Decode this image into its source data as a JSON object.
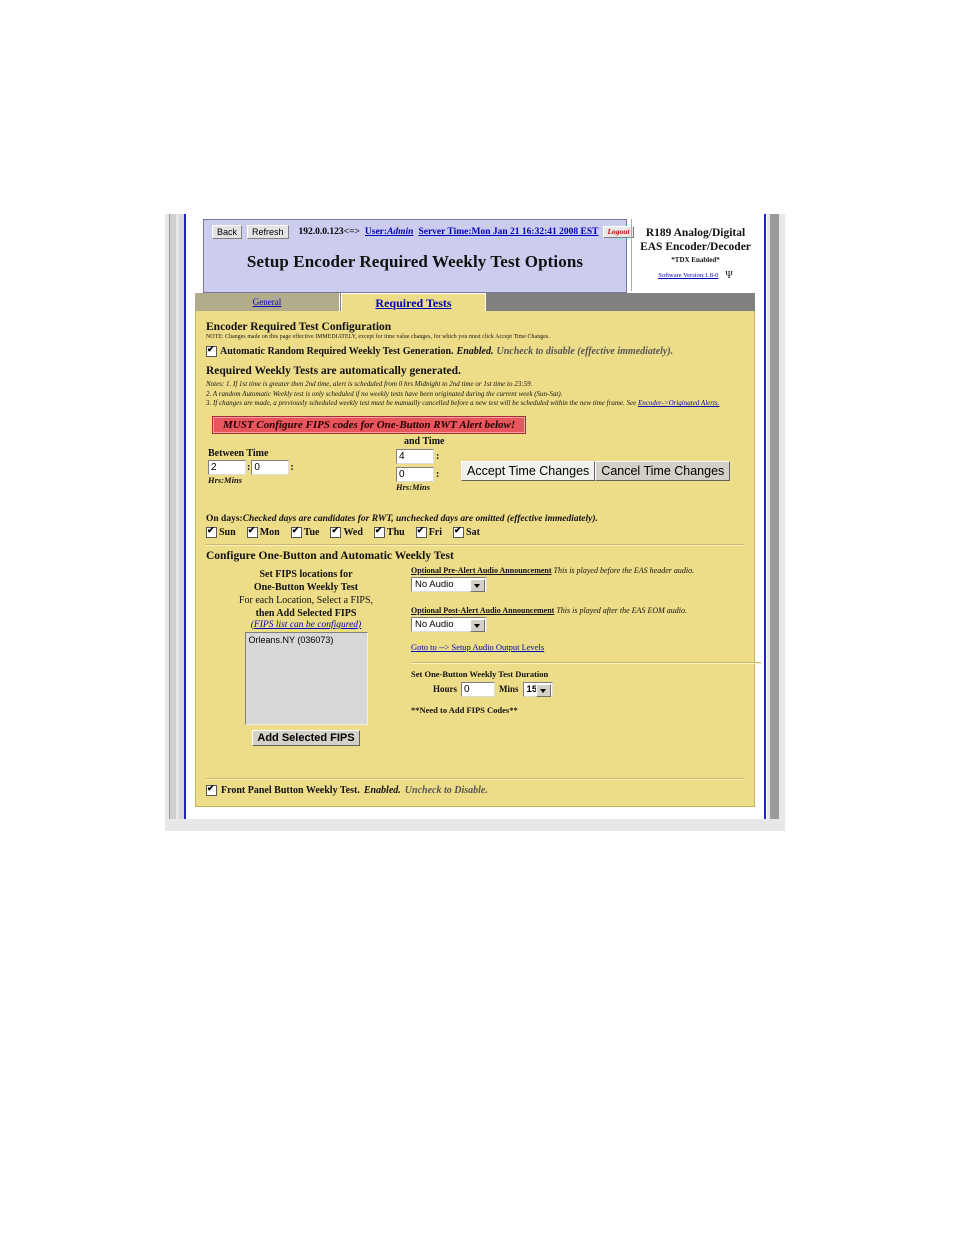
{
  "toolbar": {
    "back_label": "Back",
    "refresh_label": "Refresh",
    "ip": "192.0.0.123<=>",
    "user_label": "User:",
    "user_value": "Admin",
    "server_time": "Server Time:Mon Jan 21 16:32:41 2008 EST",
    "logout_label": "Logout"
  },
  "header": {
    "page_title": "Setup Encoder Required Weekly Test Options"
  },
  "product": {
    "line1": "R189 Analog/Digital",
    "line2": "EAS Encoder/Decoder",
    "subtitle": "*TDX Enabled*",
    "version_link": "Software Version:1.8-0",
    "logo_glyph": "Ψ"
  },
  "tabs": [
    {
      "label": "General",
      "active": false
    },
    {
      "label": "Required Tests",
      "active": true
    }
  ],
  "config": {
    "section_title": "Encoder Required Test Configuration",
    "note": "NOTE: Changes made on this page effective IMMEDIATELY, except for time value changes, for which you must click Accept Time Changes.",
    "auto_rwt_label": "Automatic Random Required Weekly Test Generation.",
    "auto_rwt_state": "Enabled.",
    "auto_rwt_hint": "Uncheck to disable (effective immediately).",
    "auto_rwt_checked": true,
    "generated_heading": "Required Weekly Tests are automatically generated.",
    "notes": [
      "Notes: 1. If 1st time is greater then 2nd time, alert is scheduled from 0 hrs Midnight to 2nd time or 1st time to 23:59.",
      "2. A random Automatic Weekly test is only scheduled if no weekly tests have been originated during the current week (Sun-Sat).",
      "3. If changes are made, a previously scheduled weekly test must be manually cancelled before a new test will be scheduled within the new time frame. See "
    ],
    "notes_link": "Encoder->Originated Alerts.",
    "warning_banner": "MUST Configure FIPS codes for One-Button RWT Alert below!"
  },
  "time": {
    "between_label": "Between Time",
    "and_label": "and Time",
    "hrs_mins_label": "Hrs:Mins",
    "start_hours": "2",
    "start_mins": "0",
    "end_hours": "4",
    "end_mins": "0",
    "accept_label": "Accept Time Changes",
    "cancel_label": "Cancel Time Changes",
    "on_days_label": "On days:",
    "on_days_hint": "Checked days are candidates for RWT, unchecked days are omitted (effective immediately).",
    "days": [
      {
        "label": "Sun",
        "checked": true
      },
      {
        "label": "Mon",
        "checked": true
      },
      {
        "label": "Tue",
        "checked": true
      },
      {
        "label": "Wed",
        "checked": true
      },
      {
        "label": "Thu",
        "checked": true
      },
      {
        "label": "Fri",
        "checked": true
      },
      {
        "label": "Sat",
        "checked": true
      }
    ]
  },
  "one_button": {
    "section_title": "Configure One-Button and Automatic Weekly Test",
    "fips_title_1": "Set FIPS locations for",
    "fips_title_2": "One-Button Weekly Test",
    "fips_title_3": "For each Location, Select a FIPS,",
    "fips_title_4": "then Add Selected FIPS",
    "fips_config_link": "(FIPS list can be configured)",
    "fips_items": [
      "Orleans.NY (036073)"
    ],
    "add_fips_label": "Add Selected FIPS",
    "pre_alert_label": "Optional Pre-Alert Audio Announcement",
    "pre_alert_desc": "This is played before the EAS header audio.",
    "pre_alert_value": "No Audio",
    "post_alert_label": "Optional Post-Alert Audio Announcement",
    "post_alert_desc": "This is played after the EAS EOM audio.",
    "post_alert_value": "No Audio",
    "audio_levels_link": "Goto to --> Setup Audio Output Levels",
    "duration_label": "Set One-Button Weekly Test Duration",
    "hours_label": "Hours",
    "hours_value": "0",
    "mins_label": "Mins",
    "mins_value": "15",
    "need_fips_note": "**Need to Add FIPS Codes**"
  },
  "front_panel": {
    "label": "Front Panel Button Weekly Test.",
    "state": "Enabled.",
    "hint": "Uncheck to Disable.",
    "checked": true
  }
}
